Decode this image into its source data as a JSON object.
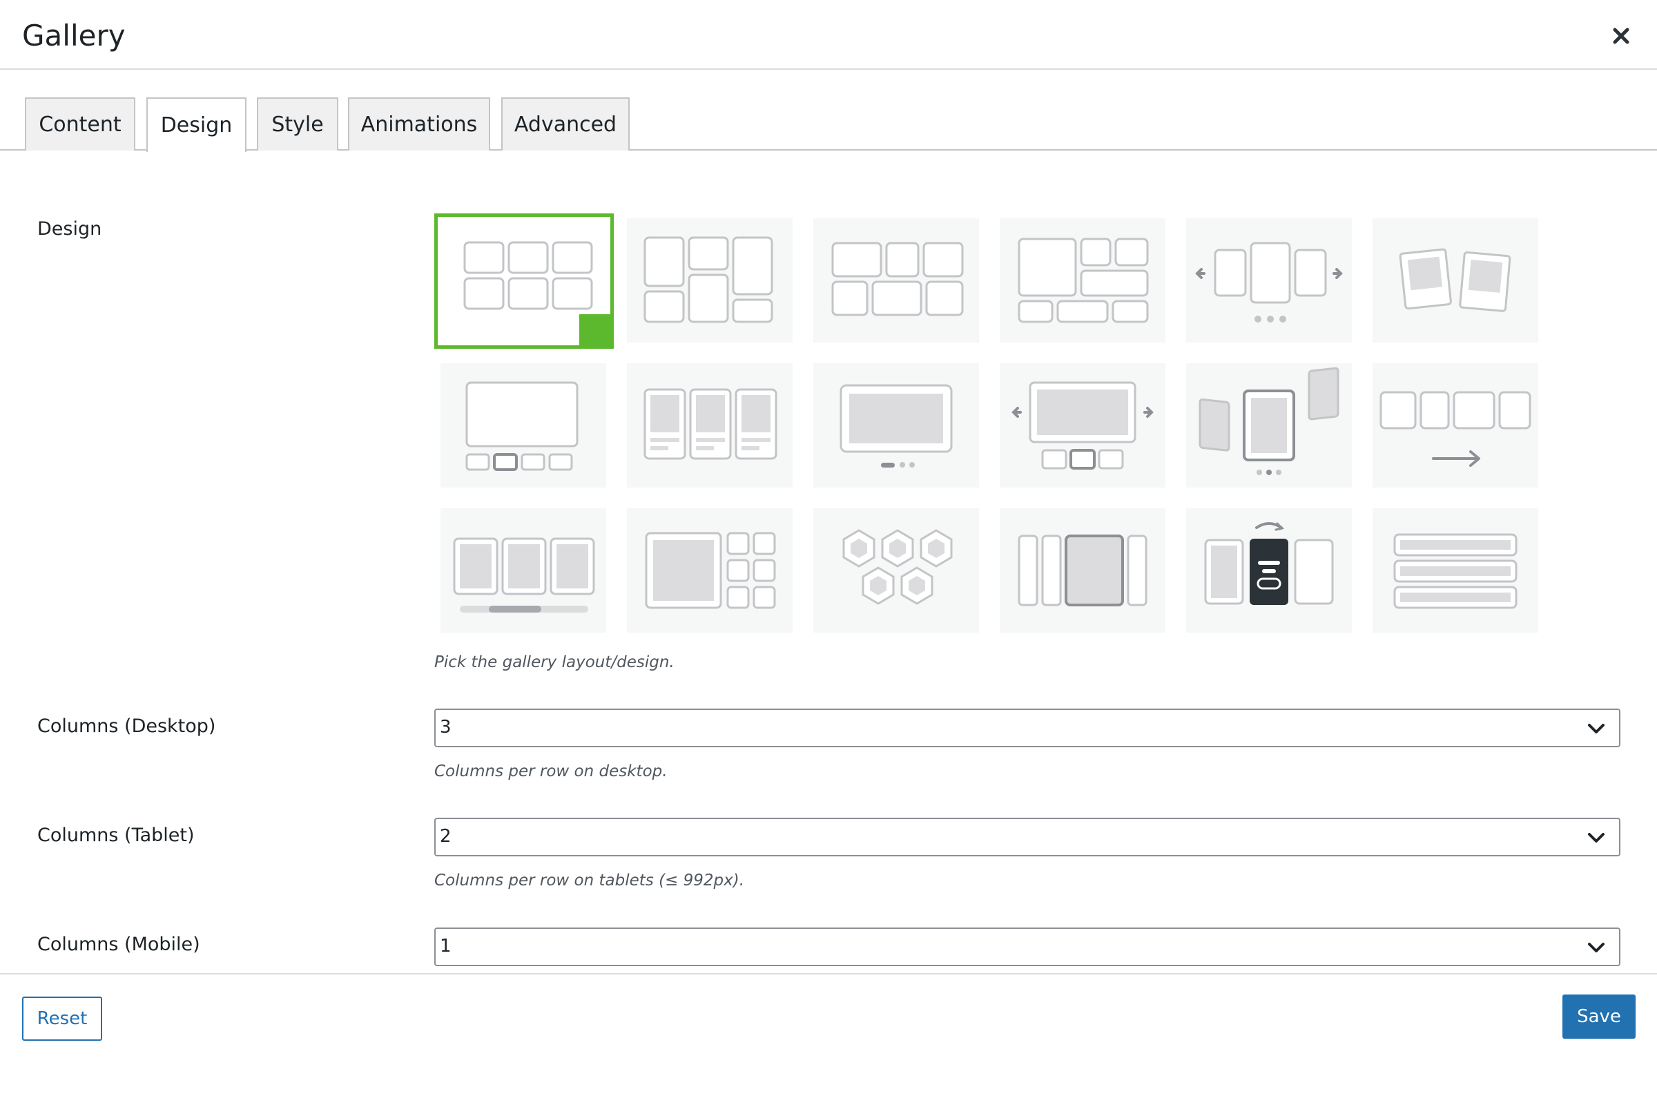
{
  "modal": {
    "title": "Gallery"
  },
  "tabs": [
    {
      "label": "Content",
      "active": false
    },
    {
      "label": "Design",
      "active": true
    },
    {
      "label": "Style",
      "active": false
    },
    {
      "label": "Animations",
      "active": false
    },
    {
      "label": "Advanced",
      "active": false
    }
  ],
  "design": {
    "label": "Design",
    "help": "Pick the gallery layout/design.",
    "selected_index": 0
  },
  "columns_desktop": {
    "label": "Columns (Desktop)",
    "value": "3",
    "help": "Columns per row on desktop."
  },
  "columns_tablet": {
    "label": "Columns (Tablet)",
    "value": "2",
    "help": "Columns per row on tablets (≤ 992px)."
  },
  "columns_mobile": {
    "label": "Columns (Mobile)",
    "value": "1"
  },
  "footer": {
    "reset_label": "Reset",
    "save_label": "Save"
  },
  "colors": {
    "accent": "#2271b1",
    "selected": "#5cb82c",
    "tile_bg": "#f6f7f7"
  }
}
